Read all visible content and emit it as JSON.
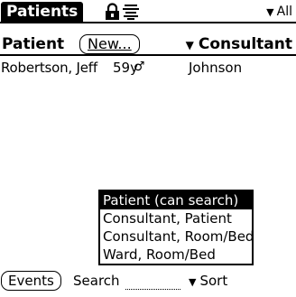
{
  "titlebar": {
    "title": "Patients",
    "category": "All",
    "icons": [
      "lock-icon",
      "signal-icon",
      "triangle-down-icon"
    ]
  },
  "header": {
    "patient_label": "Patient",
    "new_button": "New...",
    "consultant_label": "Consultant"
  },
  "patients": [
    {
      "name": "Robertson, Jeff",
      "age": "59y",
      "sex_symbol": "♂",
      "consultant": "Johnson"
    }
  ],
  "popup": {
    "items": [
      {
        "label": "Patient (can search)",
        "selected": true
      },
      {
        "label": "Consultant, Patient",
        "selected": false
      },
      {
        "label": "Consultant, Room/Bed",
        "selected": false
      },
      {
        "label": "Ward, Room/Bed",
        "selected": false
      }
    ]
  },
  "bottom": {
    "events_button": "Events",
    "search_label": "Search",
    "search_value": "",
    "sort_label": "Sort"
  }
}
